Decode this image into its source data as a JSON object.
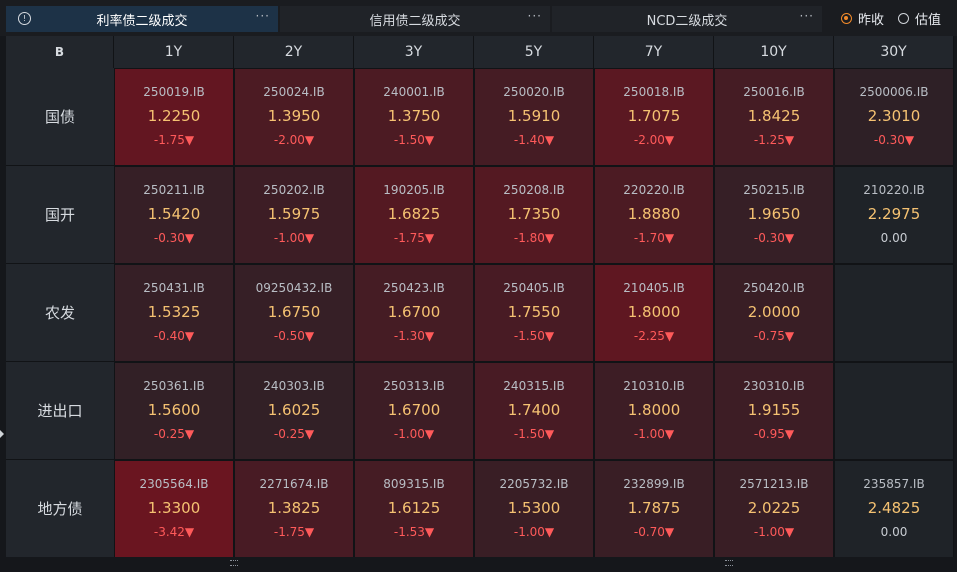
{
  "tabs": [
    {
      "label": "利率债二级成交",
      "active": true
    },
    {
      "label": "信用债二级成交",
      "active": false
    },
    {
      "label": "NCD二级成交",
      "active": false
    }
  ],
  "more_label": "···",
  "radio": [
    {
      "label": "昨收",
      "checked": true
    },
    {
      "label": "估值",
      "checked": false
    }
  ],
  "corner_icon": "B",
  "tenors": [
    "1Y",
    "2Y",
    "3Y",
    "5Y",
    "7Y",
    "10Y",
    "30Y"
  ],
  "rows": [
    {
      "label": "国债",
      "cells": [
        {
          "code": "250019.IB",
          "yield": "1.2250",
          "change": "-1.75▼",
          "intensity": 0.9
        },
        {
          "code": "250024.IB",
          "yield": "1.3950",
          "change": "-2.00▼",
          "intensity": 0.6
        },
        {
          "code": "240001.IB",
          "yield": "1.3750",
          "change": "-1.50▼",
          "intensity": 0.6
        },
        {
          "code": "250020.IB",
          "yield": "1.5910",
          "change": "-1.40▼",
          "intensity": 0.5
        },
        {
          "code": "250018.IB",
          "yield": "1.7075",
          "change": "-2.00▼",
          "intensity": 0.8
        },
        {
          "code": "250016.IB",
          "yield": "1.8425",
          "change": "-1.25▼",
          "intensity": 0.5
        },
        {
          "code": "2500006.IB",
          "yield": "2.3010",
          "change": "-0.30▼",
          "intensity": 0.2
        }
      ]
    },
    {
      "label": "国开",
      "cells": [
        {
          "code": "250211.IB",
          "yield": "1.5420",
          "change": "-0.30▼",
          "intensity": 0.3
        },
        {
          "code": "250202.IB",
          "yield": "1.5975",
          "change": "-1.00▼",
          "intensity": 0.4
        },
        {
          "code": "190205.IB",
          "yield": "1.6825",
          "change": "-1.75▼",
          "intensity": 0.7
        },
        {
          "code": "250208.IB",
          "yield": "1.7350",
          "change": "-1.80▼",
          "intensity": 0.7
        },
        {
          "code": "220220.IB",
          "yield": "1.8880",
          "change": "-1.70▼",
          "intensity": 0.6
        },
        {
          "code": "250215.IB",
          "yield": "1.9650",
          "change": "-0.30▼",
          "intensity": 0.3
        },
        {
          "code": "210220.IB",
          "yield": "2.2975",
          "change": "0.00",
          "intensity": 0.0
        }
      ]
    },
    {
      "label": "农发",
      "cells": [
        {
          "code": "250431.IB",
          "yield": "1.5325",
          "change": "-0.40▼",
          "intensity": 0.3
        },
        {
          "code": "09250432.IB",
          "yield": "1.6750",
          "change": "-0.50▼",
          "intensity": 0.3
        },
        {
          "code": "250423.IB",
          "yield": "1.6700",
          "change": "-1.30▼",
          "intensity": 0.5
        },
        {
          "code": "250405.IB",
          "yield": "1.7550",
          "change": "-1.50▼",
          "intensity": 0.55
        },
        {
          "code": "210405.IB",
          "yield": "1.8000",
          "change": "-2.25▼",
          "intensity": 0.85
        },
        {
          "code": "250420.IB",
          "yield": "2.0000",
          "change": "-0.75▼",
          "intensity": 0.35
        },
        null
      ]
    },
    {
      "label": "进出口",
      "cells": [
        {
          "code": "250361.IB",
          "yield": "1.5600",
          "change": "-0.25▼",
          "intensity": 0.25
        },
        {
          "code": "240303.IB",
          "yield": "1.6025",
          "change": "-0.25▼",
          "intensity": 0.25
        },
        {
          "code": "250313.IB",
          "yield": "1.6700",
          "change": "-1.00▼",
          "intensity": 0.4
        },
        {
          "code": "240315.IB",
          "yield": "1.7400",
          "change": "-1.50▼",
          "intensity": 0.55
        },
        {
          "code": "210310.IB",
          "yield": "1.8000",
          "change": "-1.00▼",
          "intensity": 0.4
        },
        {
          "code": "230310.IB",
          "yield": "1.9155",
          "change": "-0.95▼",
          "intensity": 0.4
        },
        null
      ]
    },
    {
      "label": "地方债",
      "cells": [
        {
          "code": "2305564.IB",
          "yield": "1.3300",
          "change": "-3.42▼",
          "intensity": 1.0
        },
        {
          "code": "2271674.IB",
          "yield": "1.3825",
          "change": "-1.75▼",
          "intensity": 0.55
        },
        {
          "code": "809315.IB",
          "yield": "1.6125",
          "change": "-1.53▼",
          "intensity": 0.5
        },
        {
          "code": "2205732.IB",
          "yield": "1.5300",
          "change": "-1.00▼",
          "intensity": 0.35
        },
        {
          "code": "232899.IB",
          "yield": "1.7875",
          "change": "-0.70▼",
          "intensity": 0.35
        },
        {
          "code": "2571213.IB",
          "yield": "2.0225",
          "change": "-1.00▼",
          "intensity": 0.35
        },
        {
          "code": "235857.IB",
          "yield": "2.4825",
          "change": "0.00",
          "intensity": 0.0
        }
      ]
    }
  ],
  "colors": {
    "accent": "#f08a2a",
    "yield": "#f5c272",
    "down": "#ff5a5a",
    "neutral_cell": "#1f2328",
    "hot_cell": "#6a1520"
  }
}
